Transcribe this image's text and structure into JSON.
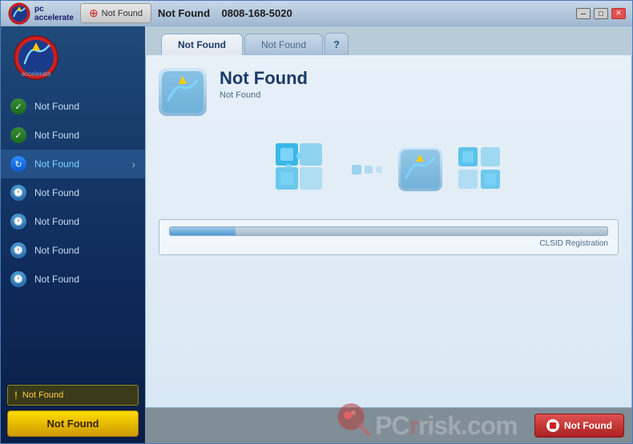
{
  "window": {
    "title": "PC Accelerate"
  },
  "titlebar": {
    "scan_button_label": "Not Found",
    "app_title": "Not Found",
    "phone": "0808-168-5020"
  },
  "tabs": {
    "tab1_label": "Not Found",
    "tab2_label": "Not Found",
    "tab_help_label": "?"
  },
  "sidebar": {
    "items": [
      {
        "label": "Not Found",
        "icon": "check",
        "active": false
      },
      {
        "label": "Not Found",
        "icon": "check",
        "active": false
      },
      {
        "label": "Not Found",
        "icon": "refresh",
        "active": true
      },
      {
        "label": "Not Found",
        "icon": "clock",
        "active": false
      },
      {
        "label": "Not Found",
        "icon": "clock",
        "active": false
      },
      {
        "label": "Not Found",
        "icon": "clock",
        "active": false
      },
      {
        "label": "Not Found",
        "icon": "clock",
        "active": false
      }
    ],
    "warning_label": "Not Found",
    "action_button_label": "Not Found"
  },
  "panel": {
    "title": "Not Found",
    "subtitle": "Not Found"
  },
  "progress": {
    "label": "CLSID Registration",
    "fill_percent": 15
  },
  "bottom": {
    "pcrisk_text": "PC",
    "pcrisk_suffix": "risk.com",
    "action_button_label": "Not Found"
  }
}
